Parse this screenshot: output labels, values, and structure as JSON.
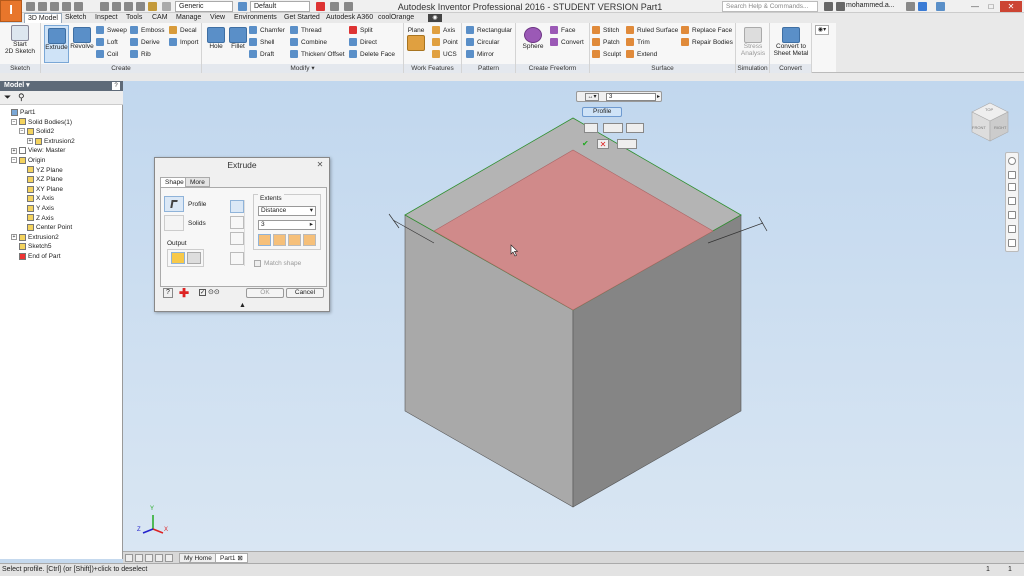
{
  "app": {
    "logo": "I",
    "window_title": "Autodesk Inventor Professional 2016 - STUDENT VERSION    Part1",
    "material": "Generic",
    "appearance": "Default",
    "search_placeholder": "Search Help & Commands...",
    "user": "mohammed.a...",
    "win_min": "—",
    "win_max": "□",
    "win_close": "✕"
  },
  "tabs": [
    "3D Model",
    "Sketch",
    "Inspect",
    "Tools",
    "CAM",
    "Manage",
    "View",
    "Environments",
    "Get Started",
    "Autodesk A360",
    "coolOrange"
  ],
  "ribbon": {
    "sketch_group": {
      "label": "Sketch",
      "start": "Start\n2D Sketch"
    },
    "create_group": {
      "label": "Create",
      "extrude": "Extrude",
      "revolve": "Revolve",
      "col1": [
        "Sweep",
        "Loft",
        "Coil"
      ],
      "col2": [
        "Emboss",
        "Derive",
        "Rib"
      ],
      "col3": [
        "Decal",
        "Import"
      ]
    },
    "modify_group": {
      "label": "Modify",
      "hole": "Hole",
      "fillet": "Fillet",
      "col1": [
        "Chamfer",
        "Shell",
        "Draft"
      ],
      "col2": [
        "Thread",
        "Combine",
        "Thicken/ Offset"
      ],
      "col3": [
        "Split",
        "Direct",
        "Delete Face"
      ]
    },
    "work_group": {
      "label": "Work Features",
      "plane": "Plane",
      "items": [
        "Axis",
        "Point",
        "UCS"
      ]
    },
    "pattern_group": {
      "label": "Pattern",
      "items": [
        "Rectangular",
        "Circular",
        "Mirror"
      ]
    },
    "freeform_group": {
      "label": "Create Freeform",
      "sphere": "Sphere",
      "items": [
        "Face",
        "Convert"
      ]
    },
    "surface_group": {
      "label": "Surface",
      "col1": [
        "Stitch",
        "Patch",
        "Sculpt"
      ],
      "col2": [
        "Ruled Surface",
        "Trim",
        "Extend"
      ],
      "col3": [
        "Replace Face",
        "Repair Bodies"
      ]
    },
    "simulation_group": {
      "label": "Simulation",
      "stress": "Stress\nAnalysis"
    },
    "convert_group": {
      "label": "Convert",
      "sheet": "Convert to\nSheet Metal"
    }
  },
  "browser": {
    "title": "Model ▾",
    "help": "?",
    "items": [
      {
        "label": "Part1",
        "indent": 0,
        "exp": ""
      },
      {
        "label": "Solid Bodies(1)",
        "indent": 1,
        "exp": "−"
      },
      {
        "label": "Solid2",
        "indent": 2,
        "exp": "−"
      },
      {
        "label": "Extrusion2",
        "indent": 3,
        "exp": "+"
      },
      {
        "label": "View: Master",
        "indent": 1,
        "exp": "+"
      },
      {
        "label": "Origin",
        "indent": 1,
        "exp": "−"
      },
      {
        "label": "YZ Plane",
        "indent": 2,
        "exp": ""
      },
      {
        "label": "XZ Plane",
        "indent": 2,
        "exp": ""
      },
      {
        "label": "XY Plane",
        "indent": 2,
        "exp": ""
      },
      {
        "label": "X Axis",
        "indent": 2,
        "exp": ""
      },
      {
        "label": "Y Axis",
        "indent": 2,
        "exp": ""
      },
      {
        "label": "Z Axis",
        "indent": 2,
        "exp": ""
      },
      {
        "label": "Center Point",
        "indent": 2,
        "exp": ""
      },
      {
        "label": "Extrusion2",
        "indent": 1,
        "exp": "+"
      },
      {
        "label": "Sketch5",
        "indent": 1,
        "exp": ""
      },
      {
        "label": "End of Part",
        "indent": 1,
        "exp": ""
      }
    ]
  },
  "dialog": {
    "title": "Extrude",
    "close": "✕",
    "tab_shape": "Shape",
    "tab_more": "More",
    "profile": "Profile",
    "solids": "Solids",
    "output": "Output",
    "extents": "Extents",
    "extent_type": "Distance",
    "distance": "3",
    "match_shape": "Match shape",
    "ok": "OK",
    "cancel": "Cancel"
  },
  "minitoolbar": {
    "distance": "3",
    "profile": "Profile"
  },
  "viewcube": {
    "top": "TOP",
    "front": "FRONT",
    "right": "RIGHT"
  },
  "bottom_tabs": [
    "My Home",
    "Part1"
  ],
  "status": {
    "text": "Select profile. [Ctrl] (or [Shift])+click to deselect",
    "n1": "1",
    "n2": "1"
  },
  "axes": {
    "x": "X",
    "y": "Y",
    "z": "Z"
  }
}
